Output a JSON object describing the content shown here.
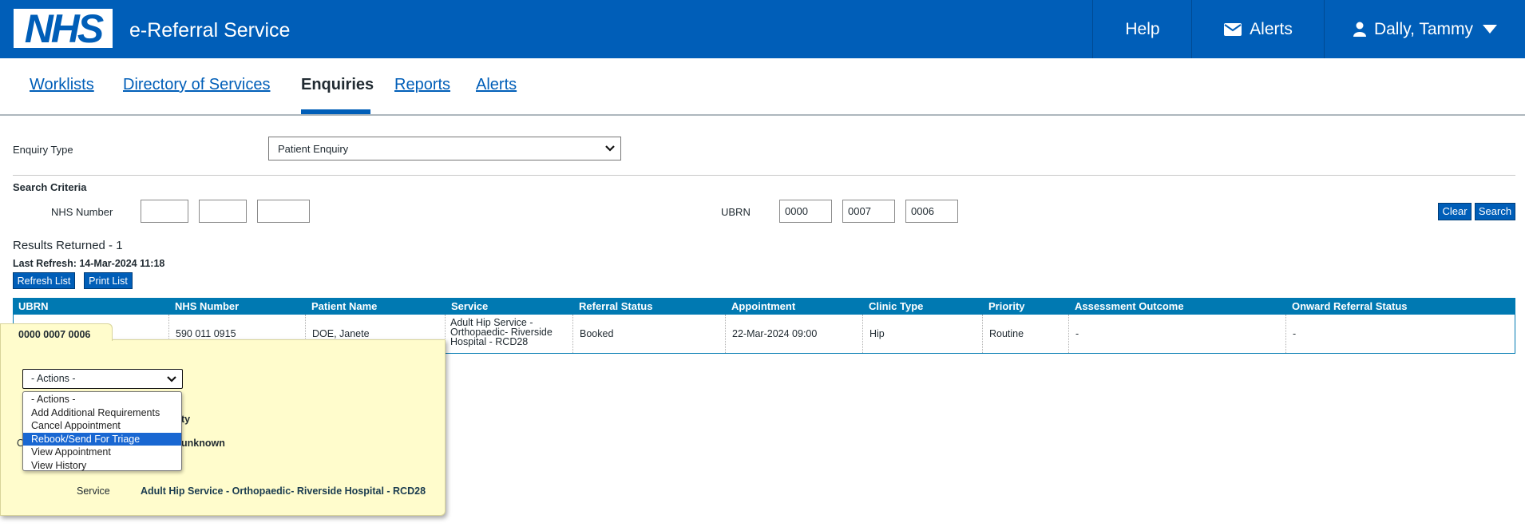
{
  "header": {
    "logo_text": "NHS",
    "service_name": "e-Referral Service",
    "help_label": "Help",
    "alerts_label": "Alerts",
    "user_name": "Dally, Tammy"
  },
  "nav": {
    "worklists": "Worklists",
    "directory": "Directory of Services",
    "enquiries": "Enquiries",
    "reports": "Reports",
    "alerts": "Alerts"
  },
  "form": {
    "enquiry_type_label": "Enquiry Type",
    "enquiry_type_value": "Patient Enquiry",
    "search_criteria_label": "Search Criteria",
    "nhs_number_label": "NHS Number",
    "nhs_number_parts": [
      "",
      "",
      ""
    ],
    "ubrn_label": "UBRN",
    "ubrn_parts": [
      "0000",
      "0007",
      "0006"
    ],
    "clear_label": "Clear",
    "search_label": "Search"
  },
  "results": {
    "returned": "Results Returned - 1",
    "last_refresh": "Last Refresh: 14-Mar-2024 11:18",
    "refresh_label": "Refresh List",
    "print_label": "Print List"
  },
  "table": {
    "headers": [
      "UBRN",
      "NHS Number",
      "Patient Name",
      "Service",
      "Referral Status",
      "Appointment",
      "Clinic Type",
      "Priority",
      "Assessment Outcome",
      "Onward Referral Status"
    ],
    "row": {
      "ubrn": "0000 0007 0006",
      "nhs_number": "590 011 0915",
      "patient_name": "DOE, Janete",
      "service_lines": [
        "Adult Hip Service -",
        "Orthopaedic- Riverside",
        "Hospital - RCD28"
      ],
      "referral_status": "Booked",
      "appointment": "22-Mar-2024 09:00",
      "clinic_type": "Hip",
      "priority": "Routine",
      "assessment_outcome": "-",
      "onward_referral_status": "-"
    }
  },
  "popup": {
    "ubrn": "0000 0007 0006",
    "actions_value": "- Actions -",
    "options": [
      "- Actions -",
      "Add Additional Requirements",
      "Cancel Appointment",
      "Rebook/Send For Triage",
      "View Appointment",
      "View History"
    ],
    "selected_option": "Rebook/Send For Triage",
    "partial_label_1": "ty",
    "partial_label_2_prefix": "C",
    "partial_value_2": "unknown",
    "service_label": "Service",
    "service_value": "Adult Hip Service - Orthopaedic- Riverside Hospital - RCD28"
  },
  "colors": {
    "nhs_blue": "#005eb8",
    "table_header": "#0079b2",
    "popup_bg": "#fffccc",
    "option_highlight": "#1967d2"
  }
}
